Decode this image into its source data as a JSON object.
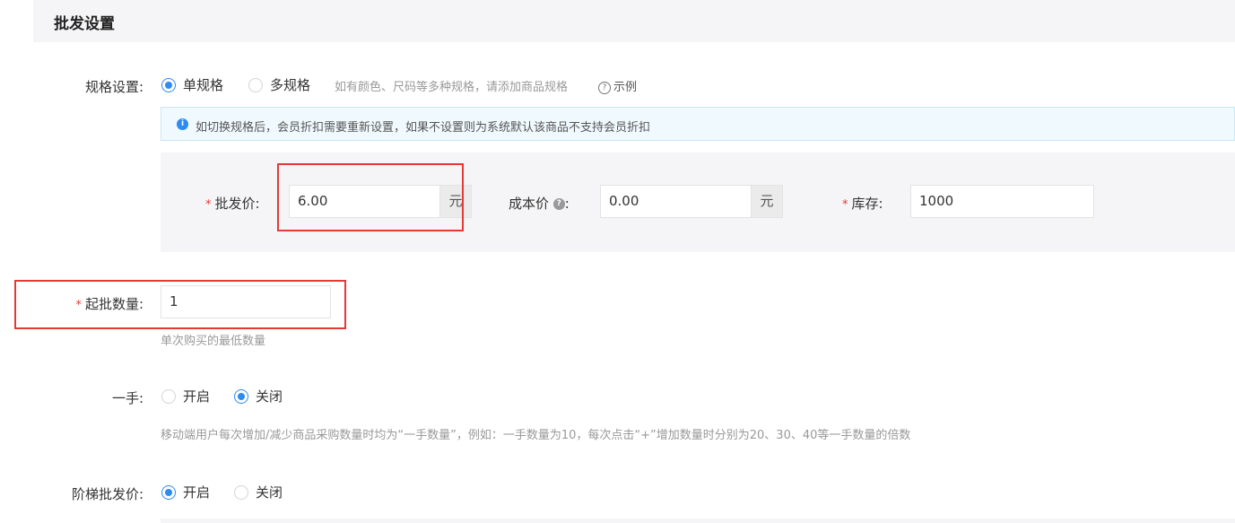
{
  "section": {
    "title": "批发设置"
  },
  "spec": {
    "label": "规格设置:",
    "options": [
      "单规格",
      "多规格"
    ],
    "selected": "单规格",
    "hint": "如有颜色、尺码等多种规格，请添加商品规格",
    "example_label": "示例",
    "info_icon_glyph": "i",
    "info": "如切换规格后，会员折扣需要重新设置，如果不设置则为系统默认该商品不支持会员折扣"
  },
  "price_fields": {
    "required_mark": "*",
    "wholesale_label": "批发价:",
    "wholesale_value": "6.00",
    "wholesale_unit": "元",
    "cost_label": "成本价",
    "cost_help_glyph": "?",
    "cost_colon": ":",
    "cost_value": "0.00",
    "cost_unit": "元",
    "stock_label": "库存:",
    "stock_value": "1000"
  },
  "min_qty": {
    "required_mark": "*",
    "label": "起批数量:",
    "value": "1",
    "hint": "单次购买的最低数量"
  },
  "lot": {
    "label": "一手:",
    "options": [
      "开启",
      "关闭"
    ],
    "selected": "关闭",
    "hint": "移动端用户每次增加/减少商品采购数量时均为“一手数量”，例如：一手数量为10，每次点击“+”增加数量时分别为20、30、40等一手数量的倍数"
  },
  "tiered": {
    "label": "阶梯批发价:",
    "options": [
      "开启",
      "关闭"
    ],
    "selected": "开启"
  },
  "colors": {
    "accent": "#2d8cf0",
    "required": "#e53935",
    "highlight": "#e53935"
  }
}
